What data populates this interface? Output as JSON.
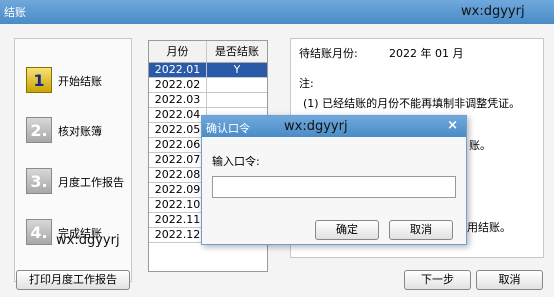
{
  "window": {
    "title": "结账",
    "watermark": "wx:dgyyrj"
  },
  "steps": [
    {
      "num": "1",
      "label": "开始结账"
    },
    {
      "num": "2.",
      "label": "核对账簿"
    },
    {
      "num": "3.",
      "label": "月度工作报告"
    },
    {
      "num": "4.",
      "label": "完成结账"
    }
  ],
  "steps_watermark": "wx:dgyyrj",
  "grid": {
    "col_month": "月份",
    "col_closed": "是否结账",
    "rows": [
      {
        "month": "2022.01",
        "closed": "Y"
      },
      {
        "month": "2022.02",
        "closed": ""
      },
      {
        "month": "2022.03",
        "closed": ""
      },
      {
        "month": "2022.04",
        "closed": ""
      },
      {
        "month": "2022.05",
        "closed": ""
      },
      {
        "month": "2022.06",
        "closed": ""
      },
      {
        "month": "2022.07",
        "closed": ""
      },
      {
        "month": "2022.08",
        "closed": ""
      },
      {
        "month": "2022.09",
        "closed": ""
      },
      {
        "month": "2022.10",
        "closed": ""
      },
      {
        "month": "2022.11",
        "closed": ""
      },
      {
        "month": "2022.12",
        "closed": ""
      }
    ]
  },
  "info": {
    "pending_label": "待结账月份:",
    "pending_value": "2022 年 01 月",
    "note_title": "注:",
    "note_1": "(1) 已经结账的月份不能再填制非调整凭证。",
    "note_frag_a": "账。",
    "note_frag_b": "用结账。"
  },
  "buttons": {
    "print_report": "打印月度工作报告",
    "next": "下一步",
    "cancel": "取消"
  },
  "dialog": {
    "title": "确认口令",
    "watermark": "wx:dgyyrj",
    "close_glyph": "×",
    "prompt": "输入口令:",
    "password_value": "",
    "ok": "确定",
    "cancel": "取消"
  },
  "colors": {
    "titlebar": "#4a8cc7",
    "selection": "#2a5aa8"
  },
  "icons": {
    "dialog_close": "close-icon"
  }
}
